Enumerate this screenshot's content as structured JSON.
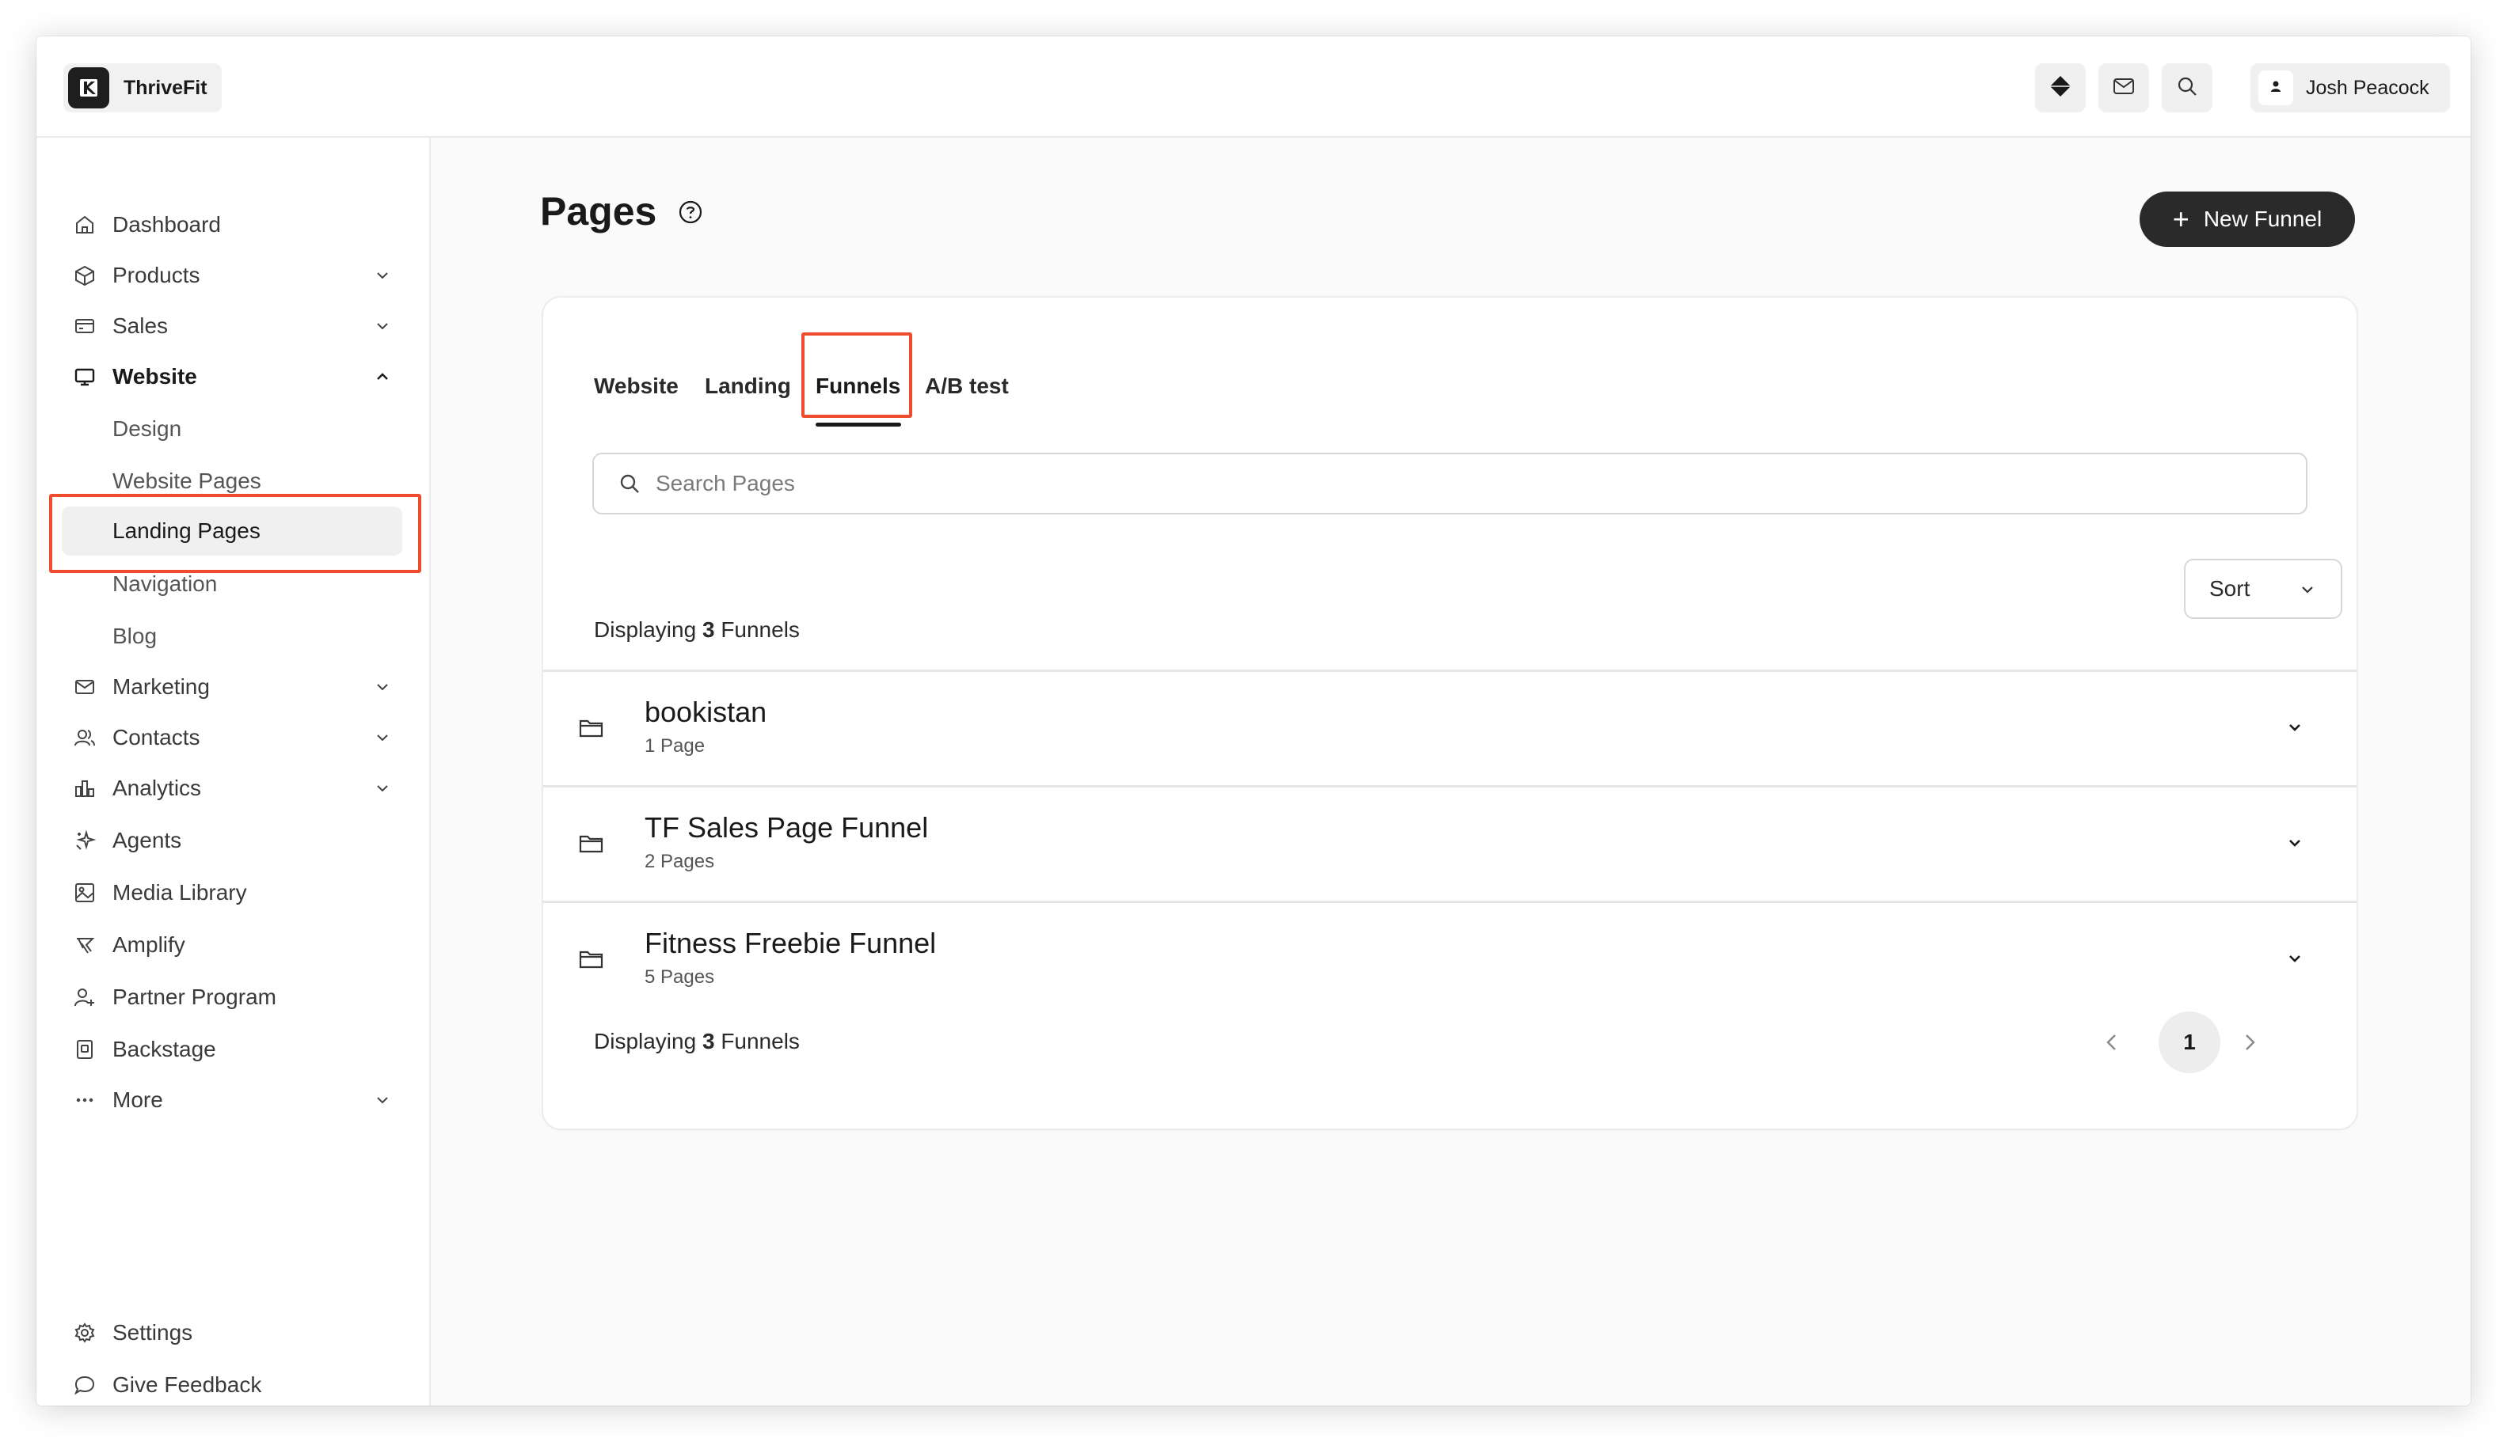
{
  "app": {
    "name": "ThriveFit"
  },
  "topbar": {
    "user_name": "Josh Peacock"
  },
  "sidebar": {
    "items": [
      {
        "label": "Dashboard",
        "icon": "home-icon"
      },
      {
        "label": "Products",
        "icon": "box-icon",
        "expandable": true
      },
      {
        "label": "Sales",
        "icon": "credit-card-icon",
        "expandable": true
      },
      {
        "label": "Website",
        "icon": "monitor-icon",
        "expanded": true
      },
      {
        "label": "Marketing",
        "icon": "mail-icon",
        "expandable": true
      },
      {
        "label": "Contacts",
        "icon": "users-icon",
        "expandable": true
      },
      {
        "label": "Analytics",
        "icon": "bar-chart-icon",
        "expandable": true
      },
      {
        "label": "Agents",
        "icon": "sparkle-icon"
      },
      {
        "label": "Media Library",
        "icon": "image-icon"
      },
      {
        "label": "Amplify",
        "icon": "megaphone-icon"
      },
      {
        "label": "Partner Program",
        "icon": "partner-icon"
      },
      {
        "label": "Backstage",
        "icon": "backstage-icon"
      },
      {
        "label": "More",
        "icon": "more-dots-icon",
        "expandable": true
      }
    ],
    "website_sub": [
      "Design",
      "Website Pages",
      "Landing Pages",
      "Navigation",
      "Blog"
    ],
    "active_sub": "Landing Pages",
    "footer": [
      {
        "label": "Settings",
        "icon": "gear-icon"
      },
      {
        "label": "Give Feedback",
        "icon": "chat-bubble-icon"
      }
    ]
  },
  "main": {
    "title": "Pages",
    "new_button": "New Funnel",
    "tabs": [
      "Website",
      "Landing",
      "Funnels",
      "A/B test"
    ],
    "active_tab": "Funnels",
    "search": {
      "placeholder": "Search Pages",
      "value": ""
    },
    "display_prefix": "Displaying",
    "display_count": "3",
    "display_suffix": "Funnels",
    "sort_label": "Sort",
    "funnels": [
      {
        "name": "bookistan",
        "pages": "1 Page"
      },
      {
        "name": "TF Sales Page Funnel",
        "pages": "2 Pages"
      },
      {
        "name": "Fitness Freebie Funnel",
        "pages": "5 Pages"
      }
    ],
    "pagination": {
      "current_page": "1"
    }
  },
  "colors": {
    "highlight": "#ee4d2d",
    "primary_button": "#2a2a2a"
  }
}
